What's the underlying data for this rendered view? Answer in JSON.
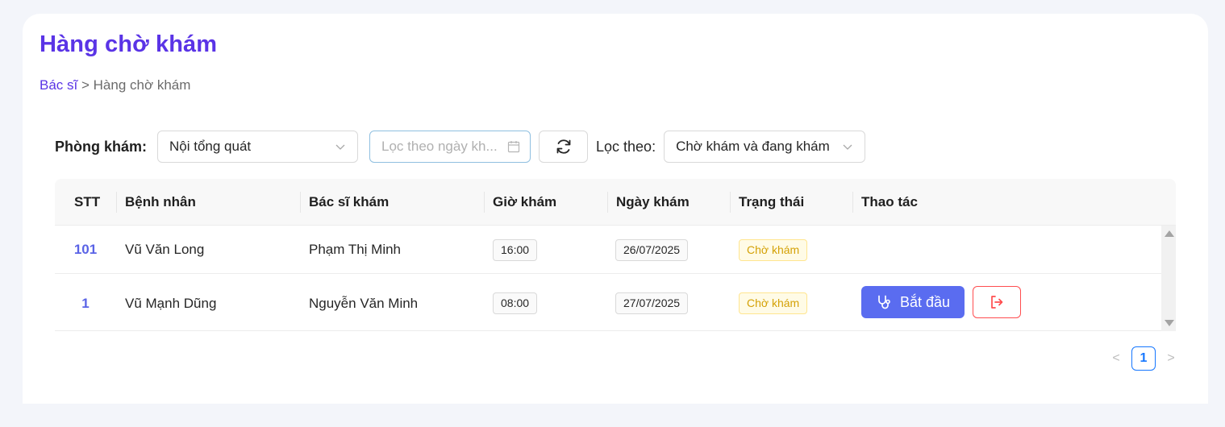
{
  "page": {
    "title": "Hàng chờ khám",
    "breadcrumb": {
      "parent": "Bác sĩ",
      "separator": ">",
      "current": "Hàng chờ khám"
    }
  },
  "toolbar": {
    "room_label": "Phòng khám:",
    "room_value": "Nội tổng quát",
    "date_placeholder": "Lọc theo ngày kh...",
    "filter_label": "Lọc theo:",
    "filter_value": "Chờ khám và đang khám"
  },
  "table": {
    "columns": [
      "STT",
      "Bệnh nhân",
      "Bác sĩ khám",
      "Giờ khám",
      "Ngày khám",
      "Trạng thái",
      "Thao tác"
    ],
    "rows": [
      {
        "stt": "101",
        "patient": "Vũ Văn Long",
        "doctor": "Phạm Thị Minh",
        "time": "16:00",
        "date": "26/07/2025",
        "status": "Chờ khám",
        "has_actions": false
      },
      {
        "stt": "1",
        "patient": "Vũ Mạnh Dũng",
        "doctor": "Nguyễn Văn Minh",
        "time": "08:00",
        "date": "27/07/2025",
        "status": "Chờ khám",
        "has_actions": true,
        "start_label": "Bắt đầu"
      }
    ]
  },
  "pagination": {
    "current_page": "1",
    "prev_symbol": "<",
    "next_symbol": ">"
  },
  "colors": {
    "brand": "#5a34e6",
    "primary_button": "#5a6cf0",
    "danger": "#ff4d4f",
    "status_text": "#d4a106",
    "page_link": "#1677ff"
  }
}
